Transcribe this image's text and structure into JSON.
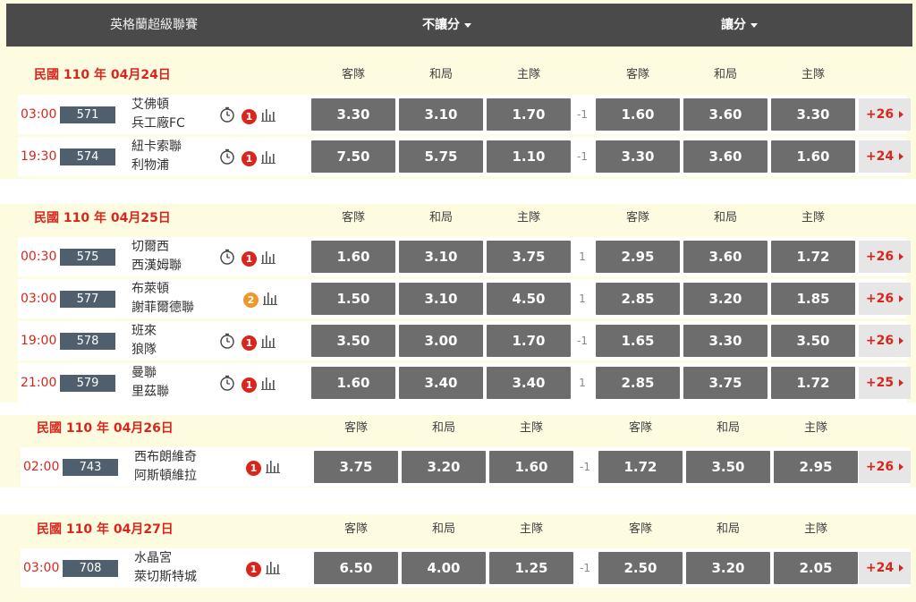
{
  "header": {
    "league": "英格蘭超級聯賽",
    "market_left": "不讓分",
    "market_right": "讓分"
  },
  "columns": [
    "客隊",
    "和局",
    "主隊",
    "客隊",
    "和局",
    "主隊"
  ],
  "colors": {
    "accent_red": "#d9261c",
    "odds_bg": "#6d6d6d",
    "header_bg": "#4a4a4a",
    "badge_orange": "#f0962a"
  },
  "sections": [
    {
      "date": "民國 110 年 04月24日",
      "rows": [
        {
          "time": "03:00",
          "code": "571",
          "away": "艾佛頓",
          "home": "兵工廠FC",
          "clock": true,
          "badge": "1",
          "badge_color": "red",
          "odds1": [
            "3.30",
            "3.10",
            "1.70"
          ],
          "handicap": "-1",
          "odds2": [
            "1.60",
            "3.60",
            "3.30"
          ],
          "more": "+26"
        },
        {
          "time": "19:30",
          "code": "574",
          "away": "紐卡索聯",
          "home": "利物浦",
          "clock": true,
          "badge": "1",
          "badge_color": "red",
          "odds1": [
            "7.50",
            "5.75",
            "1.10"
          ],
          "handicap": "-1",
          "odds2": [
            "3.30",
            "3.60",
            "1.60"
          ],
          "more": "+24"
        }
      ]
    },
    {
      "date": "民國 110 年 04月25日",
      "rows": [
        {
          "time": "00:30",
          "code": "575",
          "away": "切爾西",
          "home": "西漢姆聯",
          "clock": true,
          "badge": "1",
          "badge_color": "red",
          "odds1": [
            "1.60",
            "3.10",
            "3.75"
          ],
          "handicap": "1",
          "odds2": [
            "2.95",
            "3.60",
            "1.72"
          ],
          "more": "+26"
        },
        {
          "time": "03:00",
          "code": "577",
          "away": "布萊頓",
          "home": "謝菲爾德聯",
          "clock": false,
          "badge": "2",
          "badge_color": "orange",
          "odds1": [
            "1.50",
            "3.10",
            "4.50"
          ],
          "handicap": "1",
          "odds2": [
            "2.85",
            "3.20",
            "1.85"
          ],
          "more": "+26"
        },
        {
          "time": "19:00",
          "code": "578",
          "away": "班來",
          "home": "狼隊",
          "clock": true,
          "badge": "1",
          "badge_color": "red",
          "odds1": [
            "3.50",
            "3.00",
            "1.70"
          ],
          "handicap": "-1",
          "odds2": [
            "1.65",
            "3.30",
            "3.50"
          ],
          "more": "+26"
        },
        {
          "time": "21:00",
          "code": "579",
          "away": "曼聯",
          "home": "里茲聯",
          "clock": true,
          "badge": "1",
          "badge_color": "red",
          "odds1": [
            "1.60",
            "3.40",
            "3.40"
          ],
          "handicap": "1",
          "odds2": [
            "2.85",
            "3.75",
            "1.72"
          ],
          "more": "+25"
        }
      ]
    },
    {
      "date": "民國 110 年 04月26日",
      "rows": [
        {
          "time": "02:00",
          "code": "743",
          "away": "西布朗維奇",
          "home": "阿斯頓維拉",
          "clock": false,
          "badge": "1",
          "badge_color": "red",
          "odds1": [
            "3.75",
            "3.20",
            "1.60"
          ],
          "handicap": "-1",
          "odds2": [
            "1.72",
            "3.50",
            "2.95"
          ],
          "more": "+26"
        }
      ]
    },
    {
      "date": "民國 110 年 04月27日",
      "rows": [
        {
          "time": "03:00",
          "code": "708",
          "away": "水晶宮",
          "home": "萊切斯特城",
          "clock": false,
          "badge": "1",
          "badge_color": "red",
          "odds1": [
            "6.50",
            "4.00",
            "1.25"
          ],
          "handicap": "-1",
          "odds2": [
            "2.50",
            "3.20",
            "2.05"
          ],
          "more": "+24"
        }
      ]
    }
  ]
}
